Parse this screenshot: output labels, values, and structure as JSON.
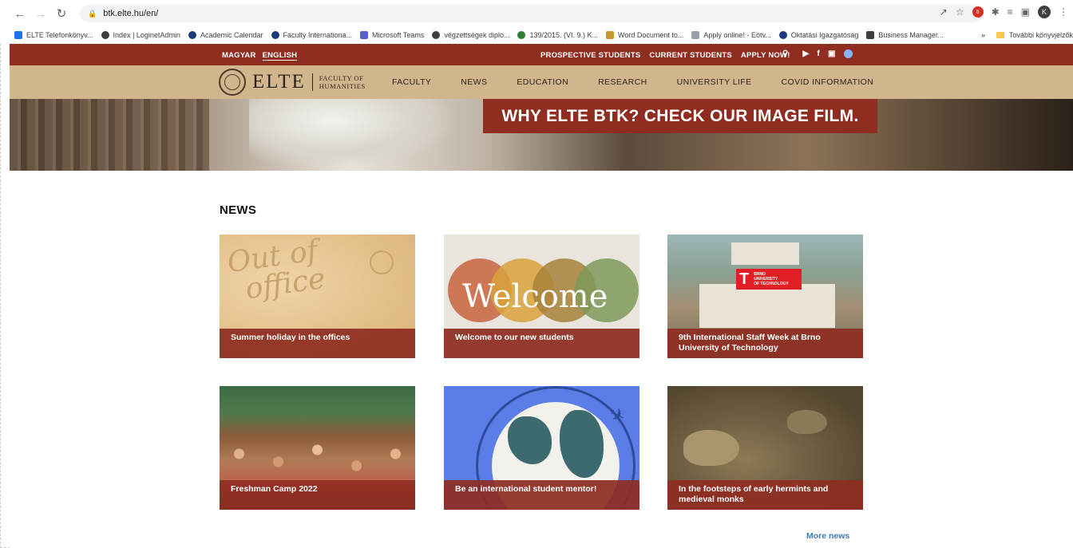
{
  "browser": {
    "url": "btk.elte.hu/en/",
    "avatar_letter": "K",
    "bookmarks": [
      {
        "label": "ELTE Telefonkönyv...",
        "icon": "phonebook-icon",
        "color": "#1a73e8"
      },
      {
        "label": "Index | LoginetAdmin",
        "icon": "globe-icon",
        "color": "#3c4043"
      },
      {
        "label": "Academic Calendar",
        "icon": "elte-icon",
        "color": "#1f3a7a"
      },
      {
        "label": "Faculty Internationa...",
        "icon": "elte-icon",
        "color": "#1f3a7a"
      },
      {
        "label": "Microsoft Teams",
        "icon": "teams-icon",
        "color": "#5b5fc7"
      },
      {
        "label": "végzettségek diplo...",
        "icon": "globe-icon",
        "color": "#3c4043"
      },
      {
        "label": "139/2015. (VI. 9.) K...",
        "icon": "gov-icon",
        "color": "#2e7d32"
      },
      {
        "label": "Word Document to...",
        "icon": "word-icon",
        "color": "#c49a2a"
      },
      {
        "label": "Apply online! - Eötv...",
        "icon": "send-icon",
        "color": "#3c4043"
      },
      {
        "label": "Oktatási Igazgatóság",
        "icon": "elte-icon",
        "color": "#1f3a7a"
      },
      {
        "label": "Business Manager...",
        "icon": "business-icon",
        "color": "#3c4043"
      }
    ],
    "more_bookmarks": "»",
    "other_bookmarks": "További könyvjelzők"
  },
  "site": {
    "lang": {
      "magyar": "MAGYAR",
      "english": "ENGLISH"
    },
    "toplinks": [
      "PROSPECTIVE STUDENTS",
      "CURRENT STUDENTS",
      "APPLY NOW!"
    ],
    "logo": {
      "name": "ELTE",
      "faculty_line1": "FACULTY OF",
      "faculty_line2": "HUMANITIES"
    },
    "nav": [
      "FACULTY",
      "NEWS",
      "EDUCATION",
      "RESEARCH",
      "UNIVERSITY LIFE",
      "COVID INFORMATION"
    ],
    "hero_banner": "WHY ELTE BTK? CHECK OUR IMAGE FILM.",
    "news_title": "NEWS",
    "news": [
      {
        "caption": "Summer holiday in the offices",
        "image_text": [
          "Out of",
          "office"
        ]
      },
      {
        "caption": "Welcome to our new students",
        "image_text": "Welcome"
      },
      {
        "caption": "9th International Staff Week at Brno University of Technology",
        "image_text": [
          "BRNO",
          "UNIVERSITY",
          "OF TECHNOLOGY"
        ]
      },
      {
        "caption": "Freshman Camp 2022"
      },
      {
        "caption": "Be an international student mentor!"
      },
      {
        "caption": "In the footsteps of early hermints and medieval monks"
      }
    ],
    "more_news": "More news"
  },
  "colors": {
    "brand_red": "#8f2d21",
    "nav_tan": "#d1b58c",
    "link_blue": "#3b7bbf"
  }
}
